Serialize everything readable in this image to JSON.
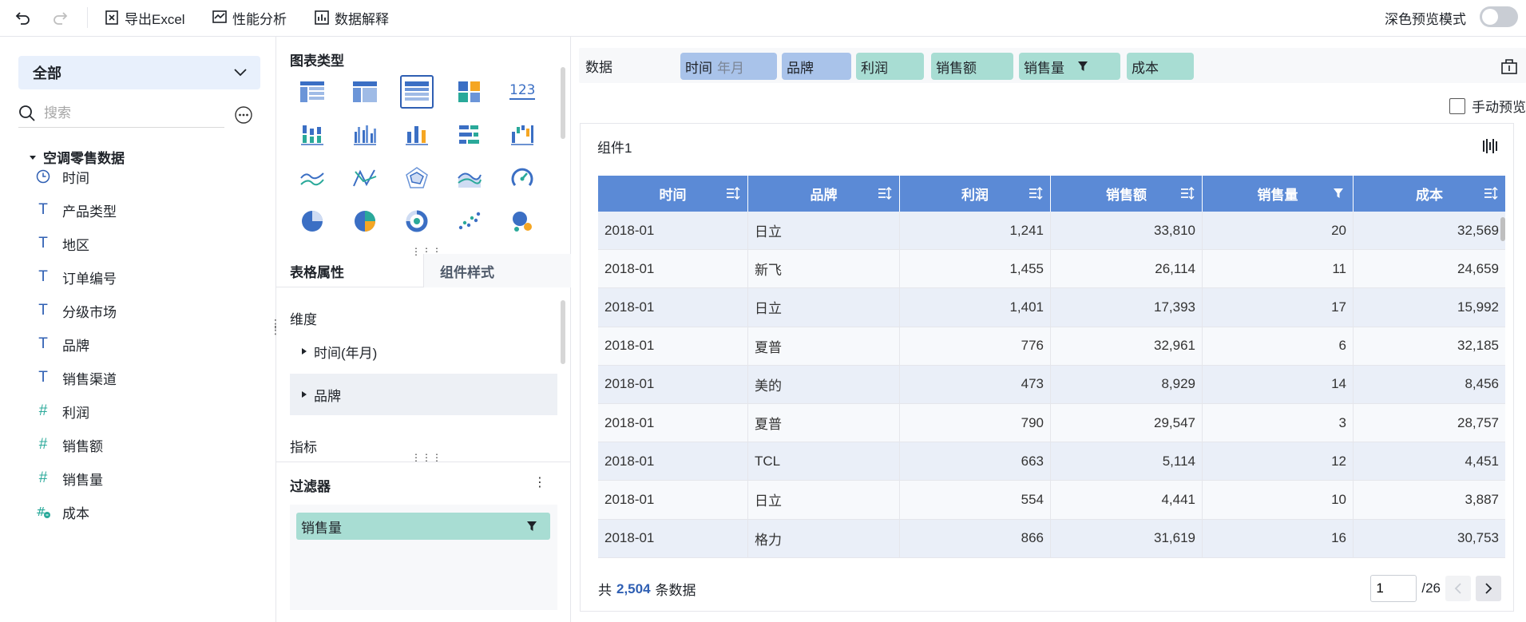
{
  "toolbar": {
    "export_label": "导出Excel",
    "perf_label": "性能分析",
    "explain_label": "数据解释",
    "dark_mode_label": "深色预览模式"
  },
  "left": {
    "dataset_select": "全部",
    "search_placeholder": "搜索",
    "tree_title": "空调零售数据",
    "fields": [
      {
        "type": "date",
        "label": "时间"
      },
      {
        "type": "text",
        "label": "产品类型"
      },
      {
        "type": "text",
        "label": "地区"
      },
      {
        "type": "text",
        "label": "订单编号"
      },
      {
        "type": "text",
        "label": "分级市场"
      },
      {
        "type": "text",
        "label": "品牌"
      },
      {
        "type": "text",
        "label": "销售渠道"
      },
      {
        "type": "number",
        "label": "利润"
      },
      {
        "type": "number",
        "label": "销售额"
      },
      {
        "type": "number",
        "label": "销售量"
      },
      {
        "type": "calc",
        "label": "成本"
      }
    ]
  },
  "middle": {
    "chart_type_title": "图表类型",
    "chart_icon_123": "123",
    "tab_table_props": "表格属性",
    "tab_widget_style": "组件样式",
    "dimension_label": "维度",
    "dimension_items": [
      "时间(年月)",
      "品牌"
    ],
    "indicator_label": "指标",
    "filter_title": "过滤器",
    "filter_chip": "销售量"
  },
  "right": {
    "data_label": "数据",
    "pills": [
      {
        "label": "时间",
        "sub": "年月",
        "kind": "dim"
      },
      {
        "label": "品牌",
        "kind": "dim"
      },
      {
        "label": "利润",
        "kind": "mea"
      },
      {
        "label": "销售额",
        "kind": "mea"
      },
      {
        "label": "销售量",
        "kind": "mea",
        "filter": true
      },
      {
        "label": "成本",
        "kind": "mea"
      }
    ],
    "manual_preview": "手动预览",
    "widget_title": "组件1",
    "columns": [
      "时间",
      "品牌",
      "利润",
      "销售额",
      "销售量",
      "成本"
    ],
    "rows": [
      [
        "2018-01",
        "日立",
        "1,241",
        "33,810",
        "20",
        "32,569"
      ],
      [
        "2018-01",
        "新飞",
        "1,455",
        "26,114",
        "11",
        "24,659"
      ],
      [
        "2018-01",
        "日立",
        "1,401",
        "17,393",
        "17",
        "15,992"
      ],
      [
        "2018-01",
        "夏普",
        "776",
        "32,961",
        "6",
        "32,185"
      ],
      [
        "2018-01",
        "美的",
        "473",
        "8,929",
        "14",
        "8,456"
      ],
      [
        "2018-01",
        "夏普",
        "790",
        "29,547",
        "3",
        "28,757"
      ],
      [
        "2018-01",
        "TCL",
        "663",
        "5,114",
        "12",
        "4,451"
      ],
      [
        "2018-01",
        "日立",
        "554",
        "4,441",
        "10",
        "3,887"
      ],
      [
        "2018-01",
        "格力",
        "866",
        "31,619",
        "16",
        "30,753"
      ]
    ],
    "footer_prefix": "共",
    "total_count": "2,504",
    "footer_suffix": "条数据",
    "page_current": "1",
    "page_total": "/26"
  },
  "colors": {
    "header_blue": "#5b8ad6",
    "dim_pill": "#a9c3ea",
    "measure_pill": "#a8ddd3",
    "accent": "#2f5fb3"
  }
}
